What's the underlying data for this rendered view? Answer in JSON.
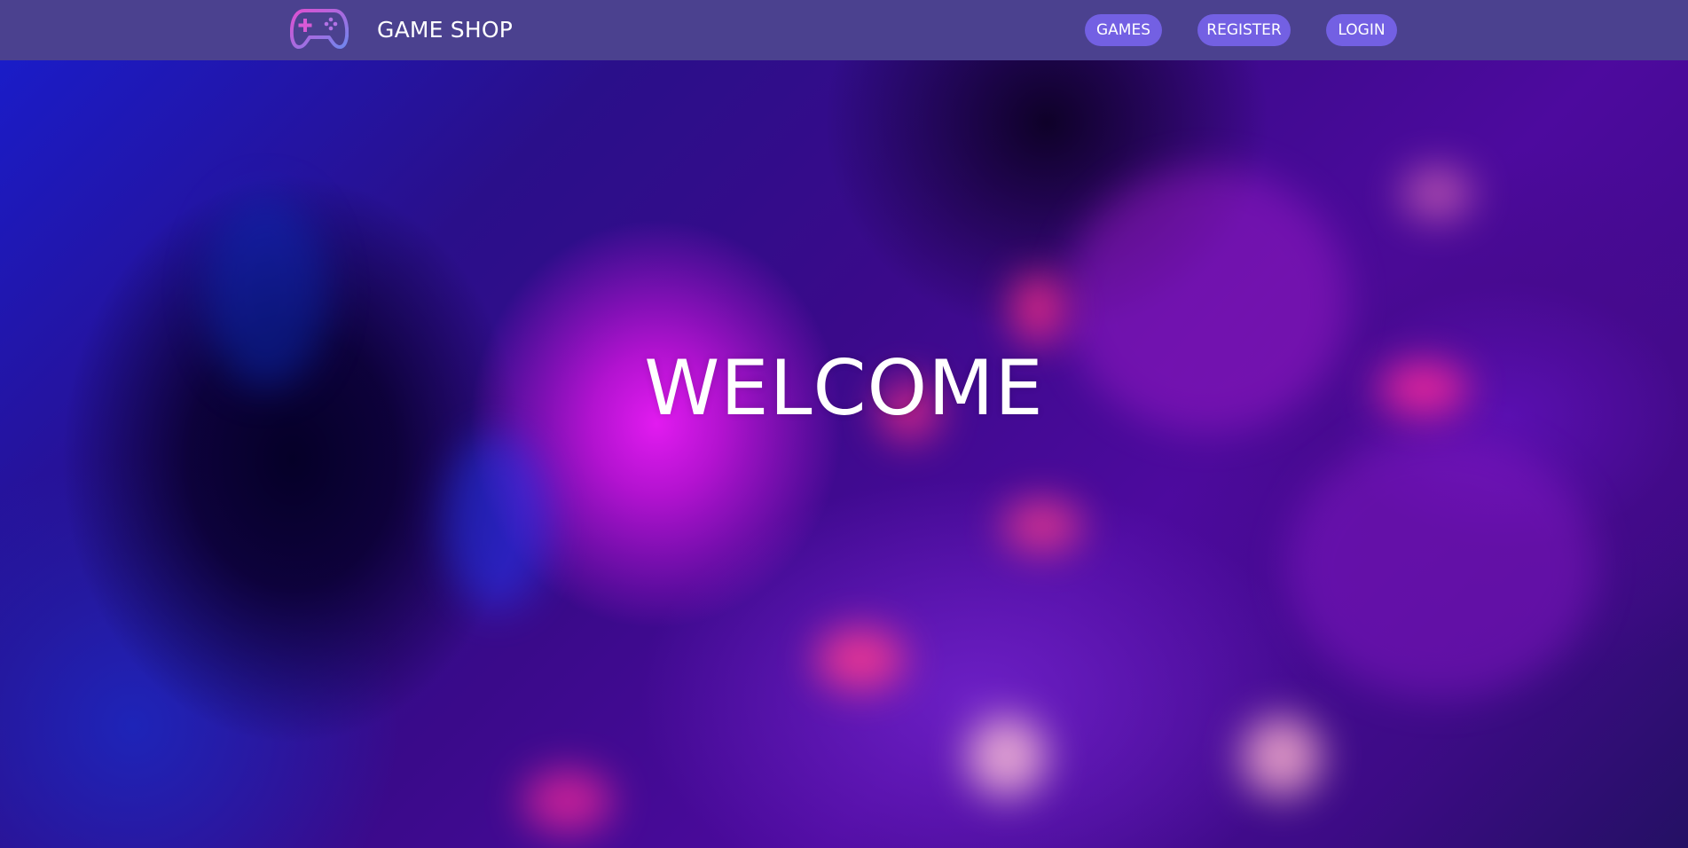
{
  "header": {
    "brand": "GAME SHOP",
    "logo_icon": "gamepad-icon",
    "nav": [
      {
        "label": "GAMES"
      },
      {
        "label": "REGISTER"
      },
      {
        "label": "LOGIN"
      }
    ]
  },
  "hero": {
    "title": "WELCOME"
  },
  "colors": {
    "navbar": "#4b418f",
    "nav_button": "#7360e3",
    "text": "#ffffff",
    "logo_gradient_start": "#d44fd6",
    "logo_gradient_end": "#6f7fe8"
  }
}
